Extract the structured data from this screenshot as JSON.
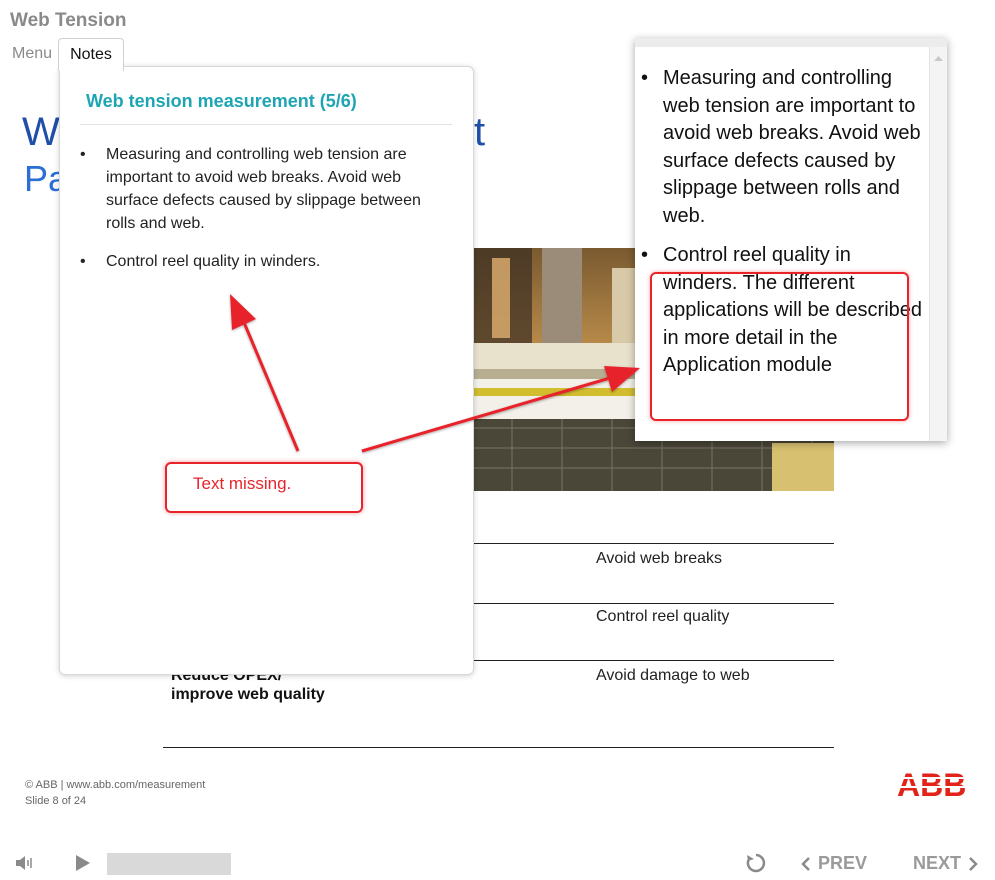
{
  "app": {
    "title": "Web Tension"
  },
  "tabs": {
    "menu": "Menu",
    "notes": "Notes"
  },
  "slide": {
    "title_left": "W",
    "title_right": "t",
    "subtitle_left": "Pa",
    "table": {
      "rows": [
        "Avoid web breaks",
        "Control reel quality",
        "Avoid damage to web"
      ],
      "left_bold_line1": "Reduce OPEX/",
      "left_bold_line2": "improve web quality"
    },
    "footer_line1": "© ABB | www.abb.com/measurement",
    "footer_line2": "Slide 8 of 24",
    "logo": "ABB"
  },
  "notes": {
    "title": "Web tension measurement (5/6)",
    "bullets": [
      "Measuring and controlling web tension are important to avoid web breaks. Avoid web surface defects caused by slippage between rolls and web.",
      "Control reel quality in winders."
    ]
  },
  "zoom": {
    "bullets": [
      "Measuring and controlling web tension are important to avoid web breaks. Avoid web surface defects caused by slippage between rolls and web.",
      "Control reel quality in winders. The different applications will be described in more detail in the Application module"
    ]
  },
  "callout": {
    "text": "Text missing."
  },
  "player": {
    "prev": "PREV",
    "next": "NEXT"
  },
  "colors": {
    "accent": "#1ea5b3",
    "annotation": "#e8242b",
    "slide_title": "#1f4fa8",
    "abb_red": "#e2231a"
  }
}
